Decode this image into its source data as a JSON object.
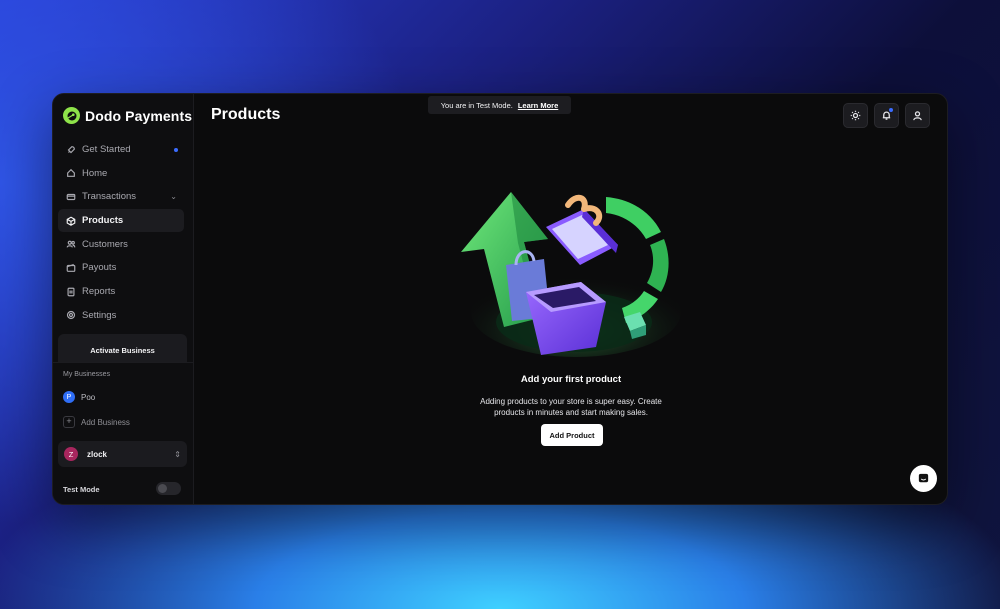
{
  "app": {
    "name": "Dodo Payments"
  },
  "header": {
    "title": "Products",
    "banner_text": "You are in Test Mode.",
    "banner_link": "Learn More"
  },
  "sidebar": {
    "items": [
      {
        "label": "Get Started",
        "icon": "rocket-icon"
      },
      {
        "label": "Home",
        "icon": "home-icon"
      },
      {
        "label": "Transactions",
        "icon": "card-icon"
      },
      {
        "label": "Products",
        "icon": "box-icon",
        "active": true
      },
      {
        "label": "Customers",
        "icon": "users-icon"
      },
      {
        "label": "Payouts",
        "icon": "wallet-icon"
      },
      {
        "label": "Reports",
        "icon": "report-icon"
      },
      {
        "label": "Settings",
        "icon": "gear-icon"
      }
    ],
    "activate_label": "Activate Business",
    "my_businesses_label": "My Businesses",
    "business": {
      "initial": "P",
      "name": "Poo"
    },
    "add_business_label": "Add Business",
    "user": {
      "initial": "Z",
      "name": "zlock"
    },
    "test_mode_label": "Test Mode"
  },
  "empty_state": {
    "title": "Add your first product",
    "subtitle_line1": "Adding products to your store is super easy. Create",
    "subtitle_line2": "products in minutes and start making sales.",
    "button_label": "Add Product"
  },
  "colors": {
    "accent": "#3b6cff",
    "brand": "#8ee34a",
    "background": "#0b0b0c"
  }
}
